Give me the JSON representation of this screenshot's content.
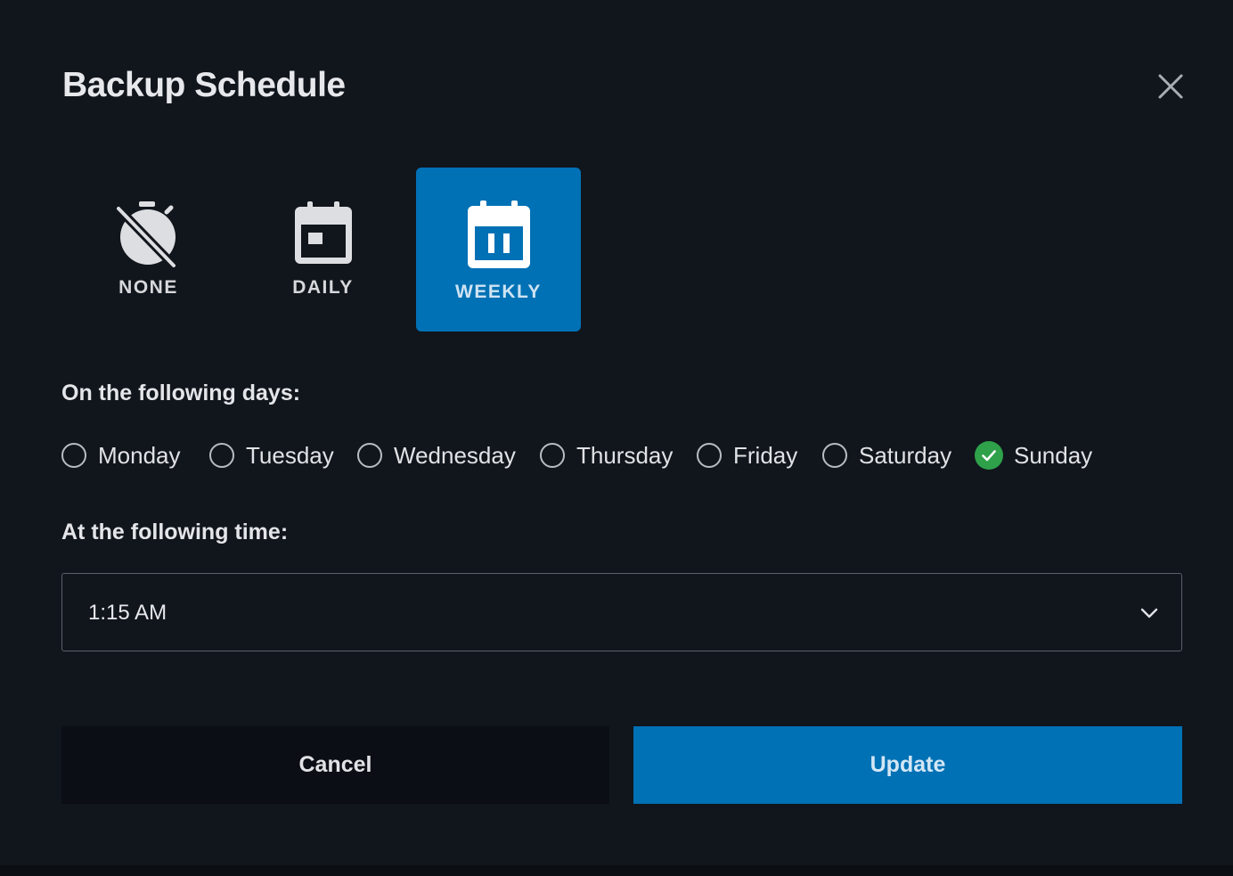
{
  "dialog": {
    "title": "Backup Schedule",
    "close_icon": "close-icon"
  },
  "frequency": {
    "options": [
      {
        "label": "NONE",
        "icon": "stopwatch-off-icon",
        "selected": false
      },
      {
        "label": "DAILY",
        "icon": "calendar-day-icon",
        "selected": false
      },
      {
        "label": "WEEKLY",
        "icon": "calendar-week-icon",
        "selected": true
      }
    ]
  },
  "days": {
    "label": "On the following days:",
    "items": [
      {
        "label": "Monday",
        "checked": false
      },
      {
        "label": "Tuesday",
        "checked": false
      },
      {
        "label": "Wednesday",
        "checked": false
      },
      {
        "label": "Thursday",
        "checked": false
      },
      {
        "label": "Friday",
        "checked": false
      },
      {
        "label": "Saturday",
        "checked": false
      },
      {
        "label": "Sunday",
        "checked": true
      }
    ]
  },
  "time": {
    "label": "At the following time:",
    "value": "1:15 AM",
    "icon": "chevron-down-icon"
  },
  "actions": {
    "cancel_label": "Cancel",
    "update_label": "Update"
  },
  "colors": {
    "accent": "#0071b5",
    "checked": "#2ea14a",
    "background": "#11151c"
  }
}
